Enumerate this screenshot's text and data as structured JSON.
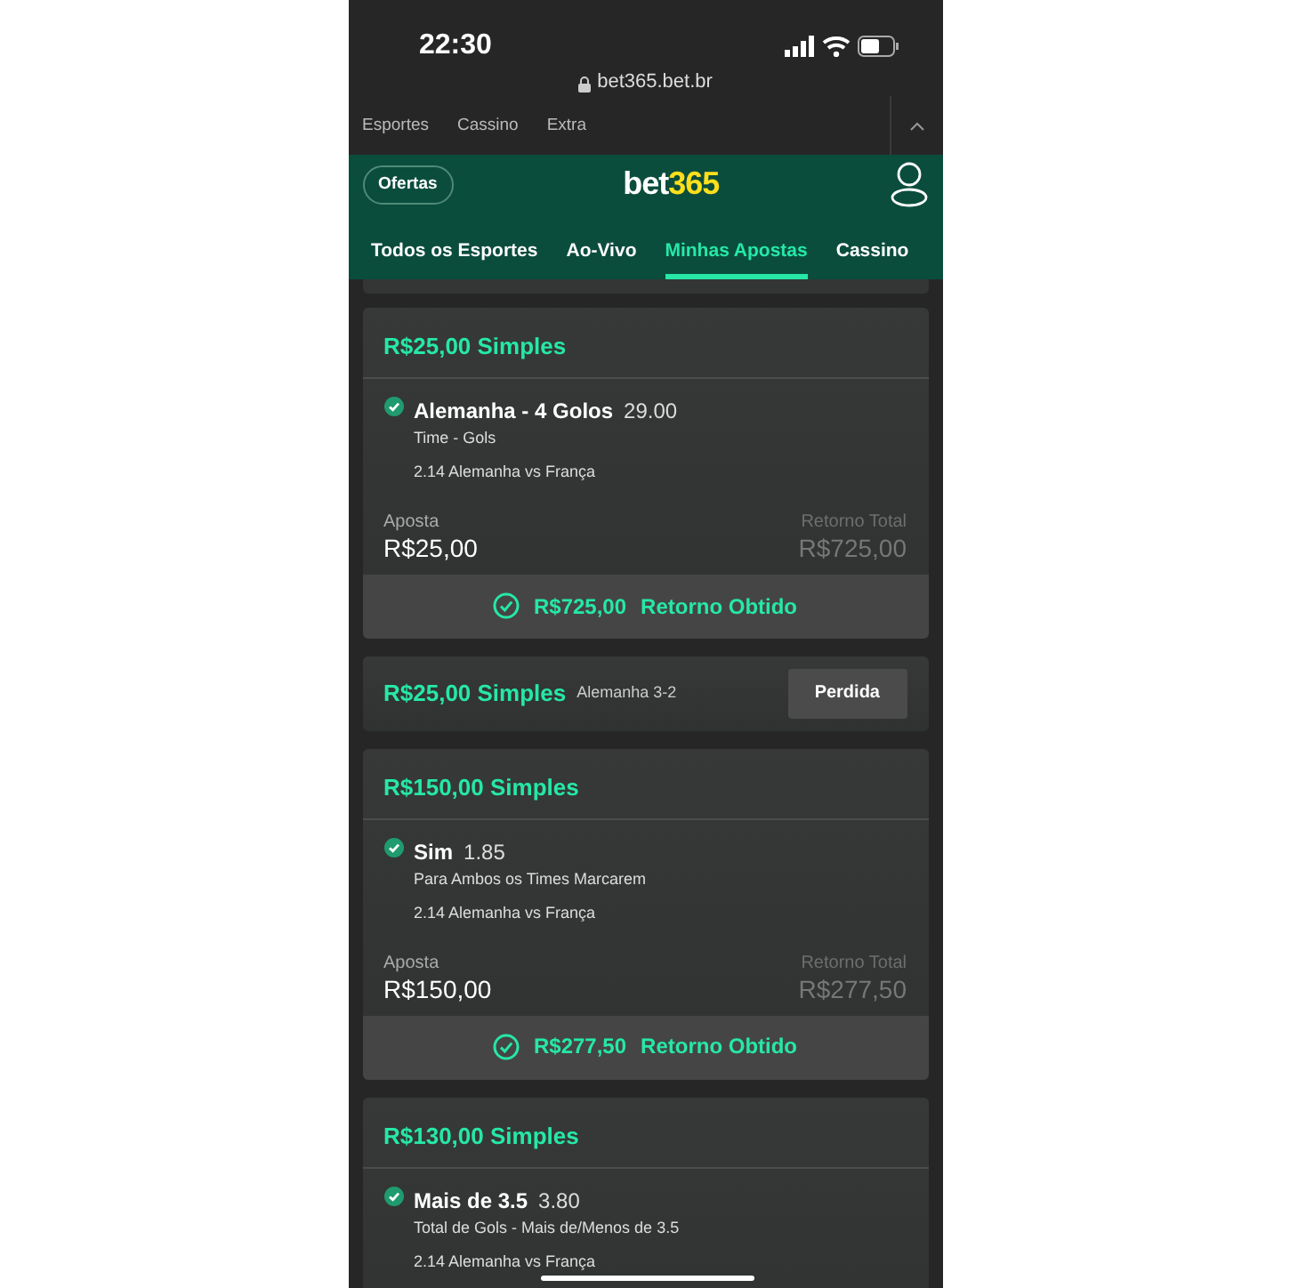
{
  "status_bar": {
    "time": "22:30"
  },
  "address_bar": {
    "url": "bet365.bet.br"
  },
  "top_nav": [
    {
      "label": "Esportes"
    },
    {
      "label": "Cassino"
    },
    {
      "label": "Extra"
    }
  ],
  "header": {
    "offers_button": "Ofertas",
    "logo_main": "bet",
    "logo_accent": "365"
  },
  "tabs": [
    {
      "label": "Todos os Esportes",
      "selected": false
    },
    {
      "label": "Ao-Vivo",
      "selected": false
    },
    {
      "label": "Minhas Apostas",
      "selected": true
    },
    {
      "label": "Cassino",
      "selected": false
    }
  ],
  "bets": [
    {
      "kind": "expanded",
      "title": "R$25,00 Simples",
      "selections": [
        {
          "name": "Alemanha - 4 Golos",
          "odds": "29.00",
          "market": "Time - Gols",
          "event": "2.14 Alemanha vs França",
          "won": true
        }
      ],
      "stake_label": "Aposta",
      "stake": "R$25,00",
      "return_label": "Retorno Total",
      "return": "R$725,00",
      "result_amount": "R$725,00",
      "result_label": "Retorno Obtido"
    },
    {
      "kind": "collapsed",
      "title": "R$25,00 Simples",
      "subtitle": "Alemanha 3-2",
      "status": "Perdida"
    },
    {
      "kind": "expanded",
      "title": "R$150,00 Simples",
      "selections": [
        {
          "name": "Sim",
          "odds": "1.85",
          "market": "Para Ambos os Times Marcarem",
          "event": "2.14 Alemanha vs França",
          "won": true
        }
      ],
      "stake_label": "Aposta",
      "stake": "R$150,00",
      "return_label": "Retorno Total",
      "return": "R$277,50",
      "result_amount": "R$277,50",
      "result_label": "Retorno Obtido"
    },
    {
      "kind": "expanded",
      "title": "R$130,00 Simples",
      "selections": [
        {
          "name": "Mais de 3.5",
          "odds": "3.80",
          "market": "Total de Gols - Mais de/Menos de 3.5",
          "event": "2.14 Alemanha vs França",
          "won": true
        }
      ]
    }
  ]
}
